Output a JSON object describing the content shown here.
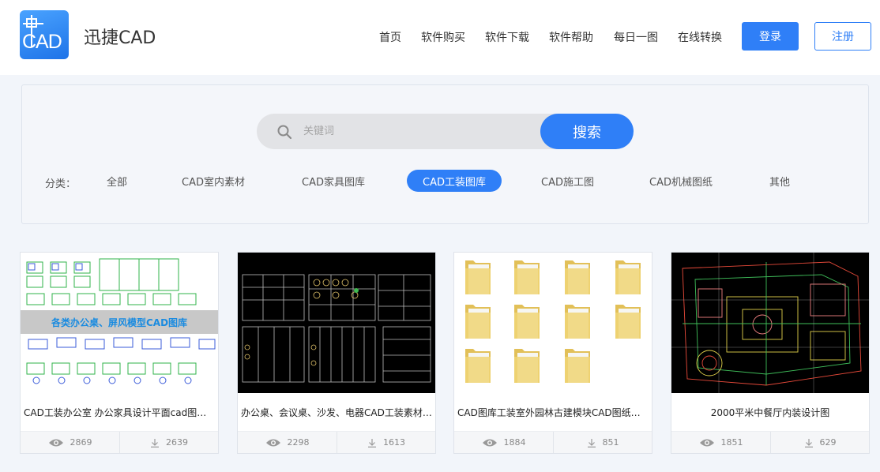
{
  "header": {
    "logo_text": "CAD",
    "brand": "迅捷CAD",
    "nav": [
      "首页",
      "软件购买",
      "软件下载",
      "软件帮助",
      "每日一图",
      "在线转换"
    ],
    "login": "登录",
    "register": "注册"
  },
  "search": {
    "placeholder": "关键词",
    "button": "搜索"
  },
  "categories": {
    "label": "分类：",
    "items": [
      "全部",
      "CAD室内素材",
      "CAD家具图库",
      "CAD工装图库",
      "CAD施工图",
      "CAD机械图纸",
      "其他"
    ],
    "active": "CAD工装图库"
  },
  "cards": [
    {
      "title": "CAD工装办公室 办公家具设计平面cad图纸下载",
      "overlay": "各类办公桌、屏风模型CAD图库",
      "views": "2869",
      "downloads": "2639"
    },
    {
      "title": "办公桌、会议桌、沙发、电器CAD工装素材图库",
      "views": "2298",
      "downloads": "1613"
    },
    {
      "title": "CAD图库工装室外园林古建模块CAD图纸下载",
      "views": "1884",
      "downloads": "851"
    },
    {
      "title": "2000平米中餐厅内装设计图",
      "views": "1851",
      "downloads": "629"
    }
  ],
  "colors": {
    "accent": "#2f7ff7",
    "logo": "#1e73e8"
  }
}
